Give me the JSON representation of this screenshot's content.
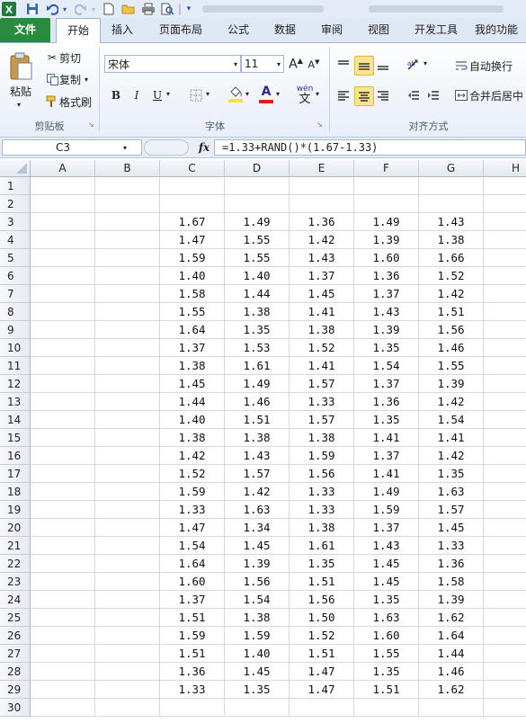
{
  "title_bar": {
    "qat_icons": [
      "excel-logo",
      "save-icon",
      "undo-icon",
      "redo-icon",
      "new-icon",
      "open-icon",
      "print-icon",
      "print-preview-icon",
      "customize-qat-icon"
    ]
  },
  "tabs": [
    "文件",
    "开始",
    "插入",
    "页面布局",
    "公式",
    "数据",
    "审阅",
    "视图",
    "开发工具",
    "我的功能"
  ],
  "active_tab": "开始",
  "ribbon": {
    "clipboard": {
      "paste": "粘贴",
      "cut": "剪切",
      "copy": "复制",
      "format_painter": "格式刷",
      "group_label": "剪贴板"
    },
    "font": {
      "font_name": "宋体",
      "font_size": "11",
      "bold": "B",
      "italic": "I",
      "underline": "U",
      "phonetic": "wén",
      "phonetic_char": "文",
      "font_color_letter": "A",
      "group_label": "字体"
    },
    "alignment": {
      "wrap_text": "自动换行",
      "merge_center": "合并后居中",
      "group_label": "对齐方式"
    },
    "colors": {
      "font_color": "#e02020",
      "fill_color": "#f5e23a",
      "selected": "#fde58f"
    }
  },
  "formula_bar": {
    "name_box": "C3",
    "fx_label": "fx",
    "formula": "=1.33+RAND()*(1.67-1.33)"
  },
  "grid": {
    "columns": [
      "A",
      "B",
      "C",
      "D",
      "E",
      "F",
      "G",
      "H"
    ],
    "row_numbers": [
      "1",
      "2",
      "3",
      "4",
      "5",
      "6",
      "7",
      "8",
      "9",
      "10",
      "11",
      "12",
      "13",
      "14",
      "15",
      "16",
      "17",
      "18",
      "19",
      "20",
      "21",
      "22",
      "23",
      "24",
      "25",
      "26",
      "27",
      "28",
      "29",
      "30"
    ],
    "data_start_row": 3,
    "data": [
      [
        "1.67",
        "1.49",
        "1.36",
        "1.49",
        "1.43"
      ],
      [
        "1.47",
        "1.55",
        "1.42",
        "1.39",
        "1.38"
      ],
      [
        "1.59",
        "1.55",
        "1.43",
        "1.60",
        "1.66"
      ],
      [
        "1.40",
        "1.40",
        "1.37",
        "1.36",
        "1.52"
      ],
      [
        "1.58",
        "1.44",
        "1.45",
        "1.37",
        "1.42"
      ],
      [
        "1.55",
        "1.38",
        "1.41",
        "1.43",
        "1.51"
      ],
      [
        "1.64",
        "1.35",
        "1.38",
        "1.39",
        "1.56"
      ],
      [
        "1.37",
        "1.53",
        "1.52",
        "1.35",
        "1.46"
      ],
      [
        "1.38",
        "1.61",
        "1.41",
        "1.54",
        "1.55"
      ],
      [
        "1.45",
        "1.49",
        "1.57",
        "1.37",
        "1.39"
      ],
      [
        "1.44",
        "1.46",
        "1.33",
        "1.36",
        "1.42"
      ],
      [
        "1.40",
        "1.51",
        "1.57",
        "1.35",
        "1.54"
      ],
      [
        "1.38",
        "1.38",
        "1.38",
        "1.41",
        "1.41"
      ],
      [
        "1.42",
        "1.43",
        "1.59",
        "1.37",
        "1.42"
      ],
      [
        "1.52",
        "1.57",
        "1.56",
        "1.41",
        "1.35"
      ],
      [
        "1.59",
        "1.42",
        "1.33",
        "1.49",
        "1.63"
      ],
      [
        "1.33",
        "1.63",
        "1.33",
        "1.59",
        "1.57"
      ],
      [
        "1.47",
        "1.34",
        "1.38",
        "1.37",
        "1.45"
      ],
      [
        "1.54",
        "1.45",
        "1.61",
        "1.43",
        "1.33"
      ],
      [
        "1.64",
        "1.39",
        "1.35",
        "1.45",
        "1.36"
      ],
      [
        "1.60",
        "1.56",
        "1.51",
        "1.45",
        "1.58"
      ],
      [
        "1.37",
        "1.54",
        "1.56",
        "1.35",
        "1.39"
      ],
      [
        "1.51",
        "1.38",
        "1.50",
        "1.63",
        "1.62"
      ],
      [
        "1.59",
        "1.59",
        "1.52",
        "1.60",
        "1.64"
      ],
      [
        "1.51",
        "1.40",
        "1.51",
        "1.55",
        "1.44"
      ],
      [
        "1.36",
        "1.45",
        "1.47",
        "1.35",
        "1.46"
      ],
      [
        "1.33",
        "1.35",
        "1.47",
        "1.51",
        "1.62"
      ]
    ]
  }
}
